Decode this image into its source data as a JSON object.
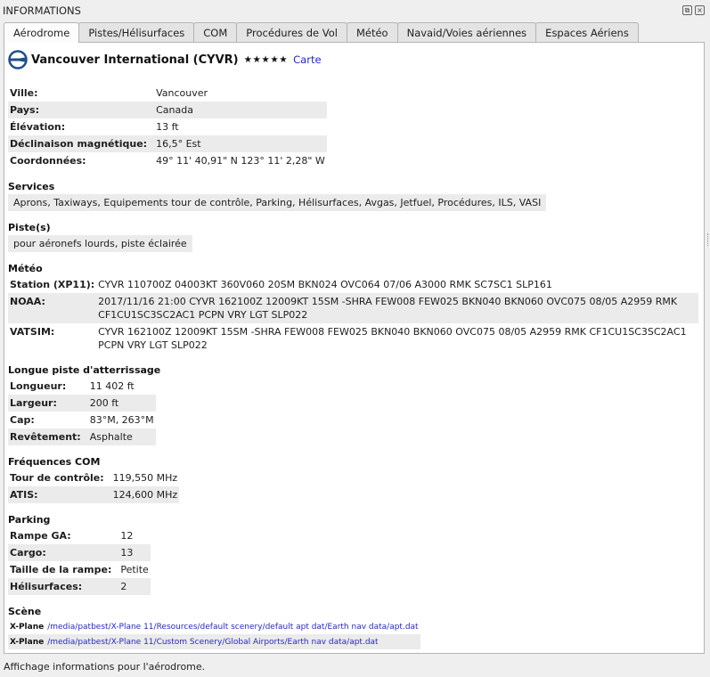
{
  "window": {
    "title": "INFORMATIONS"
  },
  "tabs": [
    {
      "label": "Aérodrome",
      "active": true
    },
    {
      "label": "Pistes/Hélisurfaces"
    },
    {
      "label": "COM"
    },
    {
      "label": "Procédures de Vol"
    },
    {
      "label": "Météo"
    },
    {
      "label": "Navaid/Voies aériennes"
    },
    {
      "label": "Espaces Aériens"
    }
  ],
  "airport": {
    "name": "Vancouver International (CYVR)",
    "rating": "★★★★★",
    "map_link": "Carte",
    "details": [
      {
        "key": "Ville:",
        "value": "Vancouver"
      },
      {
        "key": "Pays:",
        "value": "Canada"
      },
      {
        "key": "Élévation:",
        "value": "13 ft"
      },
      {
        "key": "Déclinaison magnétique:",
        "value": "16,5° Est"
      },
      {
        "key": "Coordonnées:",
        "value": "49° 11' 40,91\" N 123° 11' 2,28\" W"
      }
    ]
  },
  "services": {
    "title": "Services",
    "text": "Aprons, Taxiways, Equipements tour de contrôle, Parking, Hélisurfaces, Avgas, Jetfuel, Procédures, ILS, VASI"
  },
  "runways": {
    "title": "Piste(s)",
    "text": "pour aéronefs lourds, piste éclairée"
  },
  "meteo": {
    "title": "Météo",
    "rows": [
      {
        "key": "Station (XP11):",
        "value": "CYVR 110700Z 04003KT 360V060 20SM BKN024 OVC064 07/06 A3000 RMK SC7SC1 SLP161"
      },
      {
        "key": "NOAA:",
        "value": "2017/11/16 21:00 CYVR 162100Z 12009KT 15SM -SHRA FEW008 FEW025 BKN040 BKN060 OVC075 08/05 A2959 RMK CF1CU1SC3SC2AC1 PCPN VRY LGT SLP022"
      },
      {
        "key": "VATSIM:",
        "value": "CYVR 162100Z 12009KT 15SM -SHRA FEW008 FEW025 BKN040 BKN060 OVC075 08/05 A2959 RMK CF1CU1SC3SC2AC1 PCPN VRY LGT SLP022"
      }
    ]
  },
  "longest_runway": {
    "title": "Longue piste d'atterrissage",
    "rows": [
      {
        "key": "Longueur:",
        "value": "11 402 ft"
      },
      {
        "key": "Largeur:",
        "value": "200 ft"
      },
      {
        "key": "Cap:",
        "value": "83°M, 263°M"
      },
      {
        "key": "Revêtement:",
        "value": "Asphalte"
      }
    ]
  },
  "com": {
    "title": "Fréquences COM",
    "rows": [
      {
        "key": "Tour de contrôle:",
        "value": "119,550 MHz"
      },
      {
        "key": "ATIS:",
        "value": "124,600 MHz"
      }
    ]
  },
  "parking": {
    "title": "Parking",
    "rows": [
      {
        "key": "Rampe GA:",
        "value": "12"
      },
      {
        "key": "Cargo:",
        "value": "13"
      },
      {
        "key": "Taille de la rampe:",
        "value": "Petite"
      },
      {
        "key": "Hélisurfaces:",
        "value": "2"
      }
    ]
  },
  "scene": {
    "title": "Scène",
    "rows": [
      {
        "key": "X-Plane",
        "value": "/media/patbest/X-Plane 11/Resources/default scenery/default apt dat/Earth nav data/apt.dat"
      },
      {
        "key": "X-Plane",
        "value": "/media/patbest/X-Plane 11/Custom Scenery/Global Airports/Earth nav data/apt.dat"
      }
    ]
  },
  "statusbar": {
    "text": "Affichage informations pour l'aérodrome."
  },
  "colors": {
    "link": "#2727c8",
    "alt_row": "#ebebeb",
    "icon": "#1f4f8a"
  }
}
